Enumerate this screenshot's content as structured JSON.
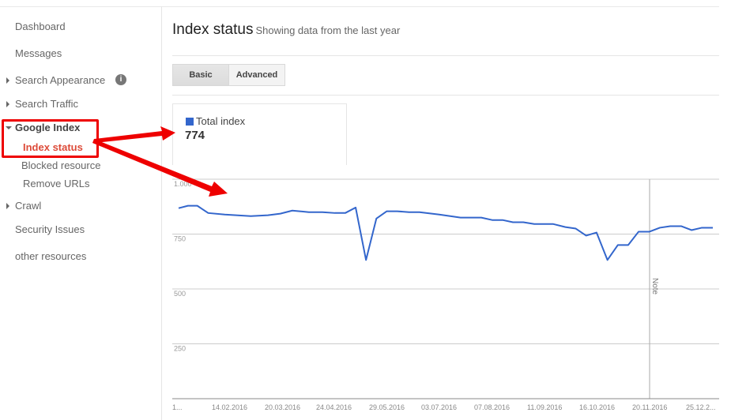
{
  "sidebar": {
    "items": [
      {
        "label": "Dashboard"
      },
      {
        "label": "Messages"
      },
      {
        "label": "Search Appearance",
        "icon": "info-icon"
      },
      {
        "label": "Search Traffic"
      },
      {
        "label": "Google Index"
      },
      {
        "label": "Crawl"
      },
      {
        "label": "Security Issues"
      },
      {
        "label": "other resources"
      }
    ],
    "google_index_sub": [
      {
        "label": "Index status",
        "active": true
      },
      {
        "label": "Blocked resource"
      },
      {
        "label": "Remove URLs"
      }
    ],
    "info_glyph": "i"
  },
  "header": {
    "title": "Index status",
    "subtitle": "Showing data from the last year"
  },
  "tabs": [
    {
      "label": "Basic",
      "selected": true
    },
    {
      "label": "Advanced",
      "selected": false
    }
  ],
  "legend": {
    "label": "Total index",
    "value": "774",
    "color": "#3366cc"
  },
  "annotation_color": "#ee0000",
  "chart_data": {
    "type": "line",
    "title": "",
    "xlabel": "",
    "ylabel": "",
    "ylim": [
      0,
      1000
    ],
    "yticks": [
      {
        "value": 1000,
        "label": "1.000"
      },
      {
        "value": 750,
        "label": "750"
      },
      {
        "value": 500,
        "label": "500"
      },
      {
        "value": 250,
        "label": "250"
      }
    ],
    "xtick_labels": [
      "1...",
      "14.02.2016",
      "20.03.2016",
      "24.04.2016",
      "29.05.2016",
      "03.07.2016",
      "07.08.2016",
      "11.09.2016",
      "16.10.2016",
      "20.11.2016",
      "25.12.2..."
    ],
    "grid": true,
    "legend": "top-left",
    "series": [
      {
        "name": "Total index",
        "color": "#3366cc",
        "values": [
          868,
          879,
          879,
          846,
          839,
          832,
          836,
          843,
          857,
          850,
          850,
          846,
          846,
          871,
          632,
          821,
          854,
          854,
          850,
          850,
          839,
          825,
          825,
          814,
          814,
          804,
          804,
          796,
          796,
          782,
          775,
          743,
          757,
          632,
          700,
          700,
          761,
          761,
          779,
          786,
          786,
          768,
          779,
          779
        ],
        "x_index": [
          0,
          0.9,
          1.8,
          2.85,
          4.45,
          6.95,
          8.6,
          9.8,
          10.95,
          12.55,
          13.85,
          15.05,
          16.05,
          17.05,
          18.05,
          19.05,
          20.05,
          21.05,
          22.2,
          23.2,
          25.1,
          27.15,
          29.15,
          30.2,
          31.2,
          32.2,
          33.2,
          34.25,
          36.05,
          37.25,
          38.25,
          39.25,
          40.25,
          41.3,
          42.3,
          43.3,
          44.3,
          45.35,
          46.35,
          47.35,
          48.4,
          49.4,
          50.4,
          51.45
        ]
      }
    ],
    "annotations": [
      {
        "label": "Note",
        "x_label": "20.11.2016"
      }
    ]
  }
}
